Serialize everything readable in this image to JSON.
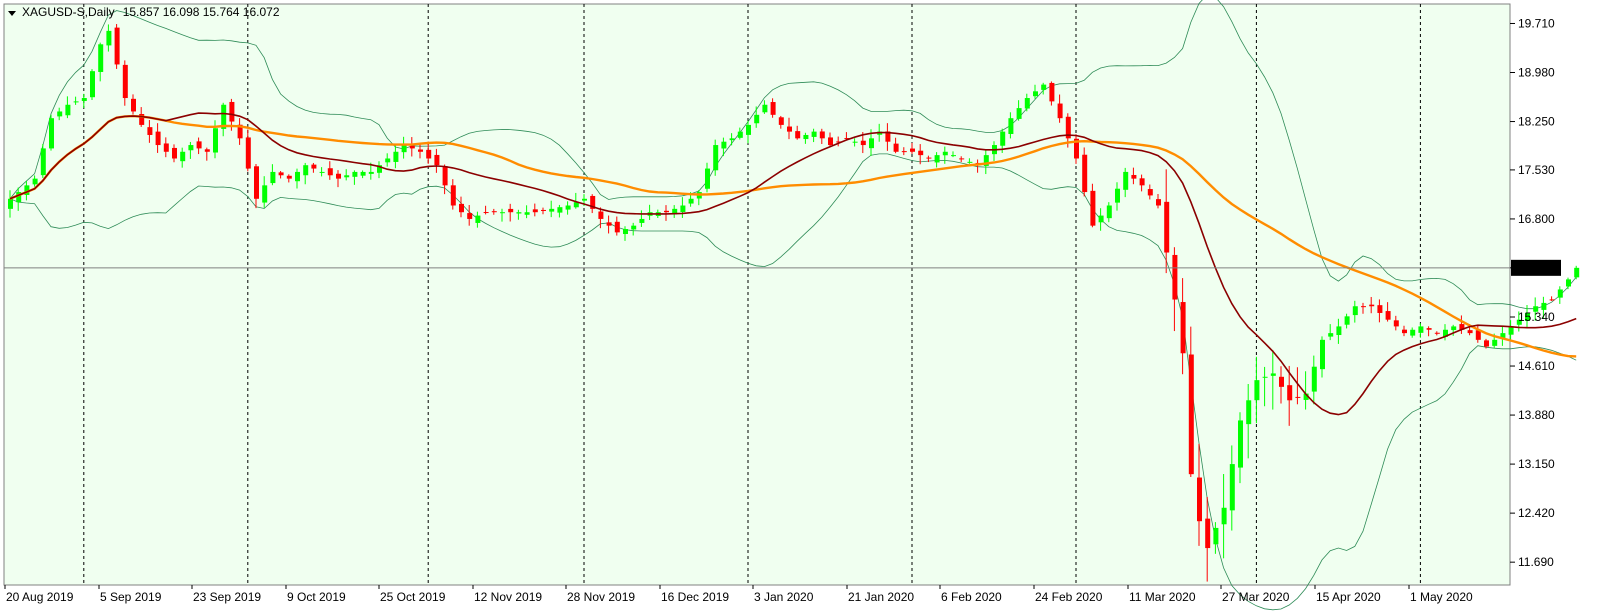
{
  "header": {
    "symbol_timeframe": "XAGUSD-S,Daily",
    "ohlc": "15.857 16.098 15.764 16.072"
  },
  "colors": {
    "background": "#f0fff0",
    "bull_candle": "#00ff00",
    "bear_candle": "#ff0000",
    "sma_fast": "#8b0000",
    "sma_slow": "#ff8c00",
    "bollinger": "#2e8b57",
    "current_price_box": "#000000"
  },
  "chart_data": {
    "type": "candlestick",
    "title": "XAGUSD-S,Daily",
    "instrument": "XAGUSD-S",
    "timeframe": "Daily",
    "ylim": [
      11.35,
      20.0
    ],
    "y_ticks": [
      "19.710",
      "18.980",
      "18.250",
      "17.530",
      "16.800",
      "16.072",
      "15.340",
      "14.610",
      "13.880",
      "13.150",
      "12.420",
      "11.690"
    ],
    "current_price": "16.072",
    "x_ticks": [
      "20 Aug 2019",
      "5 Sep 2019",
      "23 Sep 2019",
      "9 Oct 2019",
      "25 Oct 2019",
      "12 Nov 2019",
      "28 Nov 2019",
      "16 Dec 2019",
      "3 Jan 2020",
      "21 Jan 2020",
      "6 Feb 2020",
      "24 Feb 2020",
      "11 Mar 2020",
      "27 Mar 2020",
      "15 Apr 2020",
      "1 May 2020"
    ],
    "period_separators": true,
    "grid": false,
    "close_path": [
      [
        0,
        17.1
      ],
      [
        3,
        17.4
      ],
      [
        5,
        18.3
      ],
      [
        7,
        18.5
      ],
      [
        9,
        18.6
      ],
      [
        11,
        19.4
      ],
      [
        12,
        19.6
      ],
      [
        14,
        18.6
      ],
      [
        16,
        18.2
      ],
      [
        18,
        17.9
      ],
      [
        20,
        17.7
      ],
      [
        22,
        17.9
      ],
      [
        24,
        17.8
      ],
      [
        26,
        18.5
      ],
      [
        28,
        18.0
      ],
      [
        30,
        17.1
      ],
      [
        32,
        17.5
      ],
      [
        34,
        17.4
      ],
      [
        36,
        17.6
      ],
      [
        38,
        17.5
      ],
      [
        40,
        17.4
      ],
      [
        42,
        17.5
      ],
      [
        44,
        17.5
      ],
      [
        46,
        17.7
      ],
      [
        48,
        17.9
      ],
      [
        50,
        17.8
      ],
      [
        52,
        17.6
      ],
      [
        54,
        17.0
      ],
      [
        56,
        16.8
      ],
      [
        58,
        16.9
      ],
      [
        60,
        16.9
      ],
      [
        62,
        16.9
      ],
      [
        64,
        16.9
      ],
      [
        66,
        16.95
      ],
      [
        68,
        17.0
      ],
      [
        70,
        17.1
      ],
      [
        72,
        16.8
      ],
      [
        74,
        16.6
      ],
      [
        76,
        16.7
      ],
      [
        78,
        16.9
      ],
      [
        80,
        16.9
      ],
      [
        82,
        17.0
      ],
      [
        84,
        17.2
      ],
      [
        86,
        17.9
      ],
      [
        88,
        18.0
      ],
      [
        90,
        18.2
      ],
      [
        92,
        18.5
      ],
      [
        94,
        18.2
      ],
      [
        96,
        18.0
      ],
      [
        98,
        18.1
      ],
      [
        100,
        17.9
      ],
      [
        102,
        18.0
      ],
      [
        104,
        17.9
      ],
      [
        106,
        18.1
      ],
      [
        108,
        17.8
      ],
      [
        110,
        17.8
      ],
      [
        112,
        17.7
      ],
      [
        114,
        17.8
      ],
      [
        116,
        17.7
      ],
      [
        118,
        17.6
      ],
      [
        120,
        17.9
      ],
      [
        122,
        18.3
      ],
      [
        124,
        18.6
      ],
      [
        126,
        18.8
      ],
      [
        128,
        18.3
      ],
      [
        130,
        17.7
      ],
      [
        132,
        16.7
      ],
      [
        134,
        17.0
      ],
      [
        136,
        17.5
      ],
      [
        138,
        17.3
      ],
      [
        140,
        17.0
      ],
      [
        142,
        15.6
      ],
      [
        143,
        14.8
      ],
      [
        144,
        13.0
      ],
      [
        145,
        12.3
      ],
      [
        146,
        11.9
      ],
      [
        148,
        12.5
      ],
      [
        150,
        13.8
      ],
      [
        152,
        14.4
      ],
      [
        154,
        14.5
      ],
      [
        156,
        14.1
      ],
      [
        158,
        14.2
      ],
      [
        160,
        15.0
      ],
      [
        162,
        15.2
      ],
      [
        164,
        15.5
      ],
      [
        166,
        15.5
      ],
      [
        168,
        15.3
      ],
      [
        170,
        15.1
      ],
      [
        172,
        15.2
      ],
      [
        174,
        15.1
      ],
      [
        176,
        15.2
      ],
      [
        178,
        15.1
      ],
      [
        180,
        14.9
      ],
      [
        182,
        15.1
      ],
      [
        184,
        15.3
      ],
      [
        186,
        15.5
      ],
      [
        188,
        15.6
      ],
      [
        190,
        15.9
      ],
      [
        191,
        16.072
      ]
    ],
    "series": [
      {
        "name": "Candles",
        "kind": "candlestick"
      },
      {
        "kind": "line"
      },
      {
        "kind": "line"
      },
      {
        "kind": "band"
      }
    ]
  }
}
